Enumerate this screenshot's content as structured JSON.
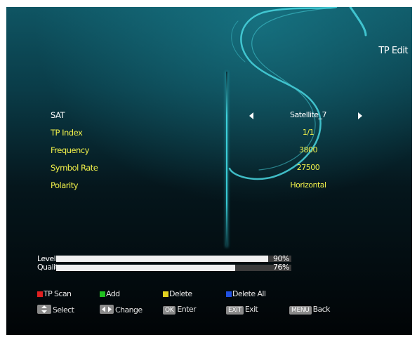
{
  "header": {
    "title": "TP Edit"
  },
  "fields": [
    {
      "label": "SAT",
      "value": "Satellite_7",
      "selected": true
    },
    {
      "label": "TP Index",
      "value": "1/1"
    },
    {
      "label": "Frequency",
      "value": "3800"
    },
    {
      "label": "Symbol Rate",
      "value": "27500"
    },
    {
      "label": "Polarity",
      "value": "Horizontal"
    }
  ],
  "signal": {
    "level": {
      "label": "Level",
      "value": "90%",
      "fraction": 0.9
    },
    "quality": {
      "label": "Qualit",
      "value": "76%",
      "fraction": 0.76
    }
  },
  "color_keys": [
    {
      "color": "#e02020",
      "label": "TP Scan"
    },
    {
      "color": "#20c020",
      "label": "Add"
    },
    {
      "color": "#e0d020",
      "label": "Delete"
    },
    {
      "color": "#2050e0",
      "label": "Delete All"
    }
  ],
  "nav_keys": {
    "select": {
      "icon": "up-down-icon",
      "label": "Select"
    },
    "change": {
      "icon": "left-right-icon",
      "label": "Change"
    },
    "enter": {
      "key": "OK",
      "label": "Enter"
    },
    "exit": {
      "key": "EXIT",
      "label": "Exit"
    },
    "back": {
      "key": "MENU",
      "label": "Back"
    }
  },
  "colors": {
    "value_yellow": "#f2f24a",
    "accent_cyan": "#3fd2dc",
    "background": "#02080c"
  }
}
